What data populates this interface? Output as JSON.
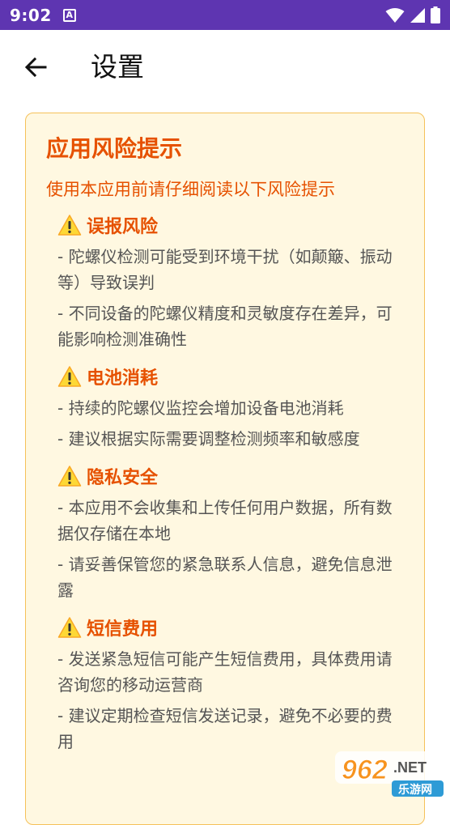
{
  "status_bar": {
    "time": "9:02",
    "notification_letter": "A"
  },
  "header": {
    "title": "设置"
  },
  "card": {
    "title": "应用风险提示",
    "subtitle": "使用本应用前请仔细阅读以下风险提示",
    "sections": [
      {
        "title": "误报风险",
        "items": [
          "- 陀螺仪检测可能受到环境干扰（如颠簸、振动等）导致误判",
          "- 不同设备的陀螺仪精度和灵敏度存在差异，可能影响检测准确性"
        ]
      },
      {
        "title": "电池消耗",
        "items": [
          "- 持续的陀螺仪监控会增加设备电池消耗",
          "- 建议根据实际需要调整检测频率和敏感度"
        ]
      },
      {
        "title": "隐私安全",
        "items": [
          "- 本应用不会收集和上传任何用户数据，所有数据仅存储在本地",
          "- 请妥善保管您的紧急联系人信息，避免信息泄露"
        ]
      },
      {
        "title": "短信费用",
        "items": [
          "- 发送紧急短信可能产生短信费用，具体费用请咨询您的移动运营商",
          "- 建议定期检查短信发送记录，避免不必要的费用"
        ]
      }
    ]
  },
  "watermark": {
    "brand": "962.NET",
    "sub": "乐游网"
  },
  "colors": {
    "status_bar": "#5e35b1",
    "card_background": "#fff8e1",
    "card_border": "#f5c15a",
    "accent": "#e65100",
    "body_text": "#555555"
  }
}
